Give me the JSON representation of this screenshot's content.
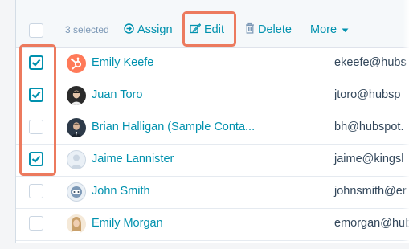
{
  "toolbar": {
    "selected_text": "3 selected",
    "assign_label": "Assign",
    "edit_label": "Edit",
    "delete_label": "Delete",
    "more_label": "More",
    "select_all_checked": false
  },
  "rows": [
    {
      "name": "Emily Keefe",
      "email": "ekeefe@hubs",
      "checked": true,
      "avatar": "hubspot-logo-avatar"
    },
    {
      "name": "Juan Toro",
      "email": "jtoro@hubsp",
      "checked": true,
      "avatar": "photo-avatar"
    },
    {
      "name": "Brian Halligan (Sample Conta...",
      "email": "bh@hubspot.",
      "checked": false,
      "avatar": "photo-avatar"
    },
    {
      "name": "Jaime Lannister",
      "email": "jaime@kingsl",
      "checked": true,
      "avatar": "default-person-avatar"
    },
    {
      "name": "John Smith",
      "email": "johnsmith@er",
      "checked": false,
      "avatar": "robot-avatar"
    },
    {
      "name": "Emily Morgan",
      "email": "emorgan@hub",
      "checked": false,
      "avatar": "photo-avatar"
    }
  ],
  "colors": {
    "link": "#0091ae",
    "checkbox_checked": "#0091ae",
    "highlight": "#ec7a5e",
    "hubspot_orange": "#ff7a59",
    "text": "#33475b"
  }
}
